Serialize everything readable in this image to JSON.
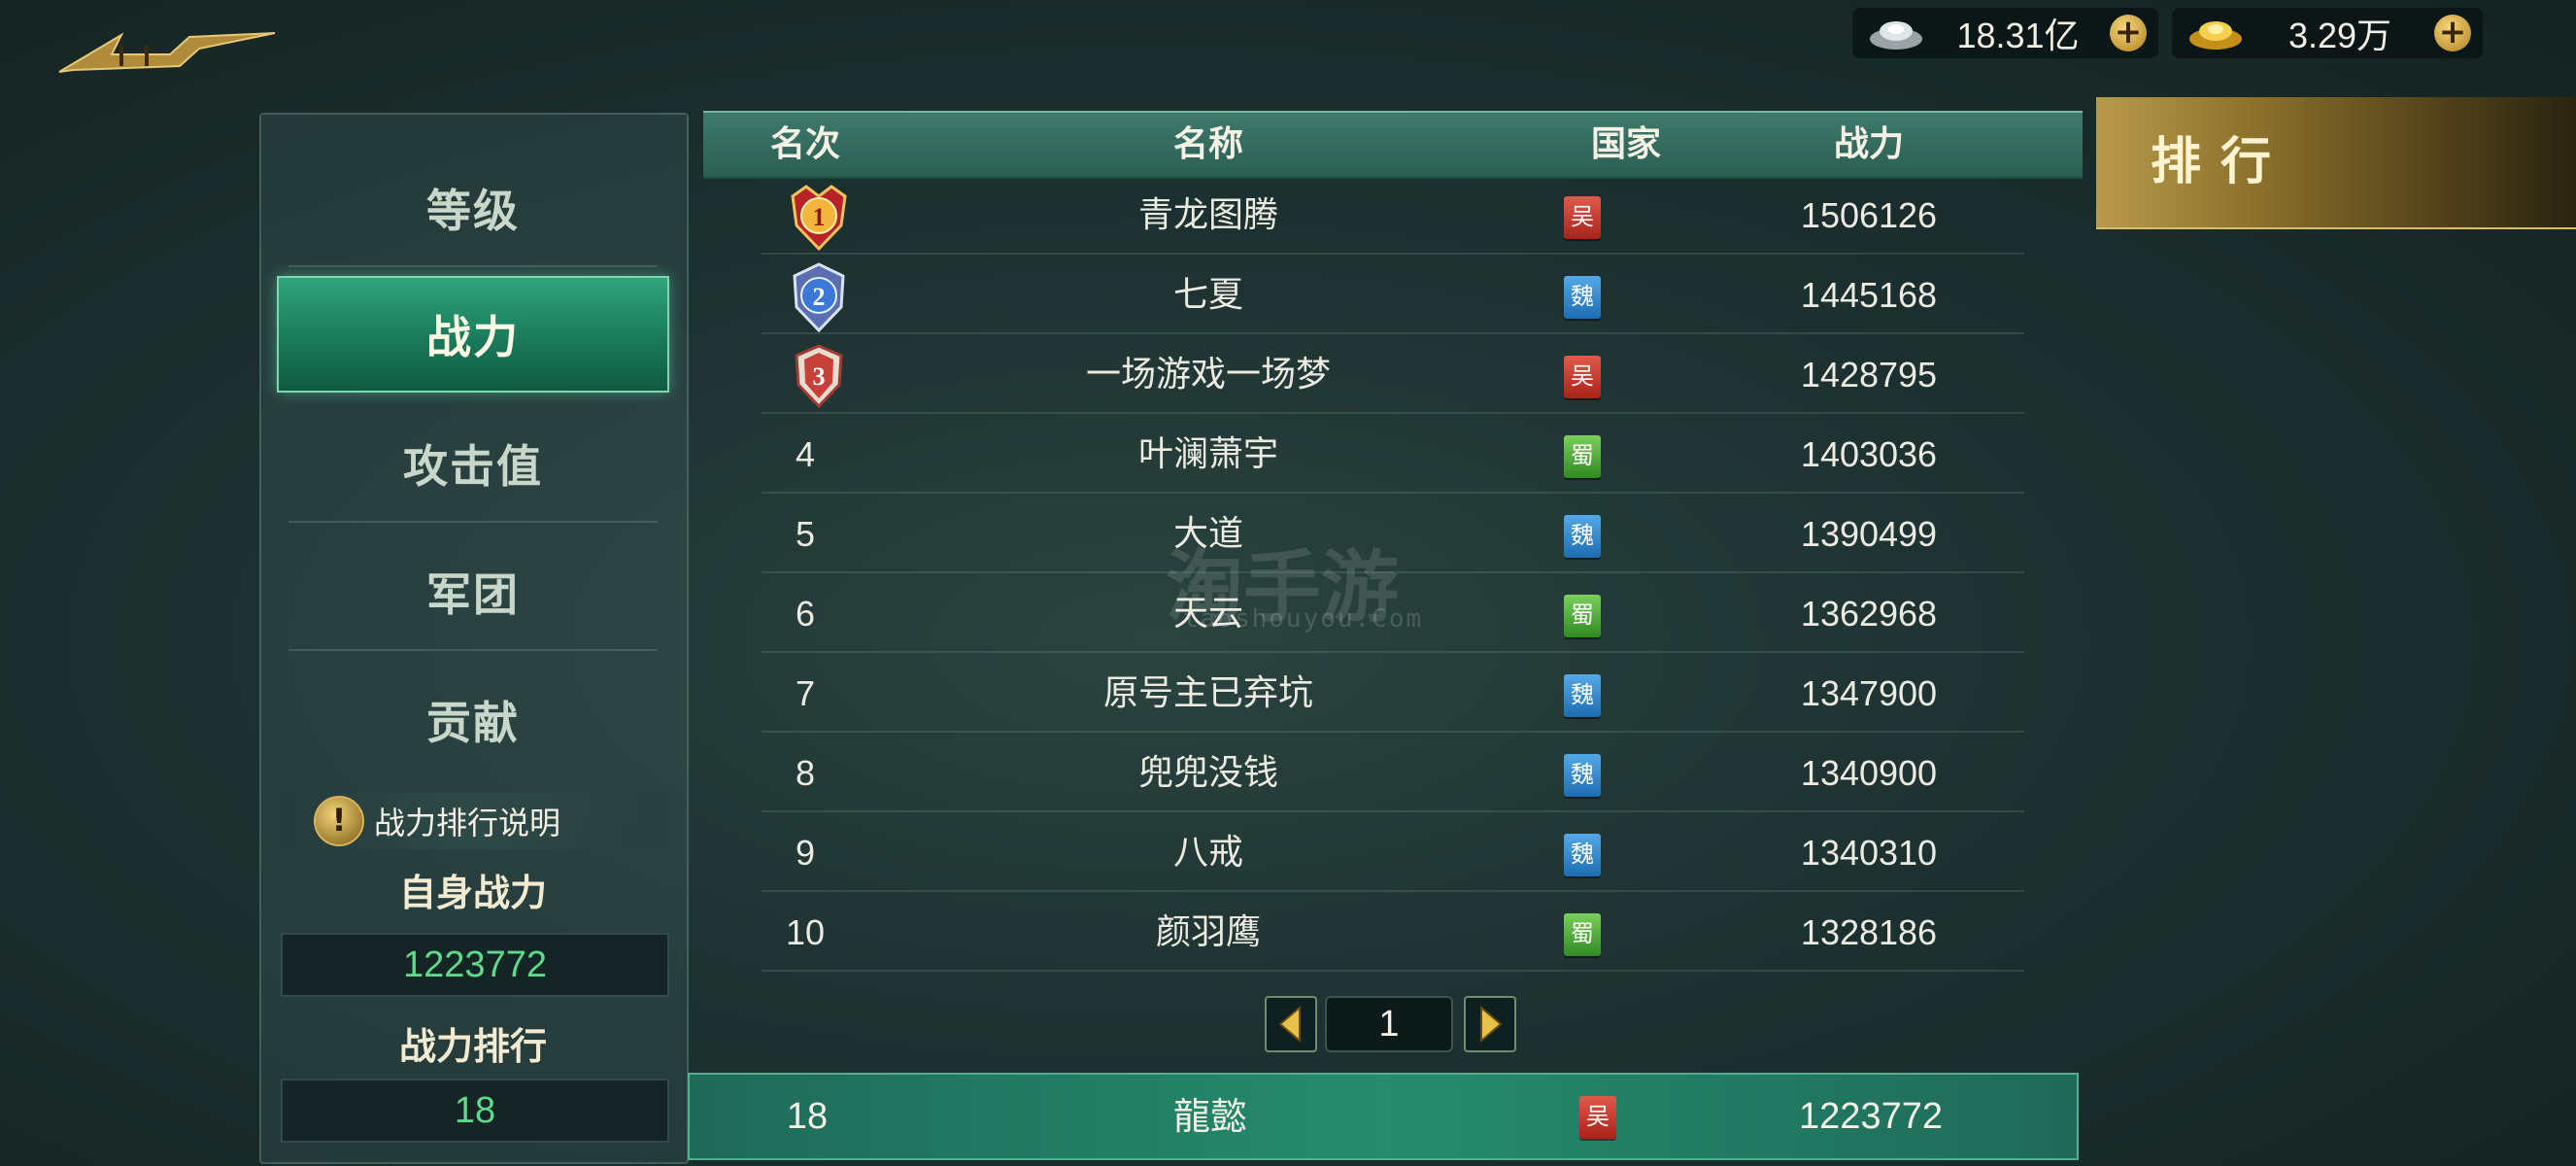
{
  "currency": {
    "silver": {
      "icon": "silver-ingot-icon",
      "value": "18.31亿"
    },
    "gold": {
      "icon": "gold-ingot-icon",
      "value": "3.29万"
    },
    "plus_label": "+"
  },
  "sidebar": {
    "items": [
      {
        "label": "等级",
        "active": false
      },
      {
        "label": "战力",
        "active": true
      },
      {
        "label": "攻击值",
        "active": false
      },
      {
        "label": "军团",
        "active": false
      },
      {
        "label": "贡献",
        "active": false
      }
    ],
    "info_icon_label": "!",
    "info_label": "战力排行说明",
    "self_power_title": "自身战力",
    "self_power_value": "1223772",
    "self_rank_title": "战力排行",
    "self_rank_value": "18"
  },
  "table": {
    "headers": {
      "rank": "名次",
      "name": "名称",
      "country": "国家",
      "power": "战力"
    },
    "rows": [
      {
        "rank": "1",
        "name": "青龙图腾",
        "country": "吴",
        "country_class": "wu",
        "power": "1506126"
      },
      {
        "rank": "2",
        "name": "七夏",
        "country": "魏",
        "country_class": "wei",
        "power": "1445168"
      },
      {
        "rank": "3",
        "name": "一场游戏一场梦",
        "country": "吴",
        "country_class": "wu",
        "power": "1428795"
      },
      {
        "rank": "4",
        "name": "叶澜萧宇",
        "country": "蜀",
        "country_class": "shu",
        "power": "1403036"
      },
      {
        "rank": "5",
        "name": "大道",
        "country": "魏",
        "country_class": "wei",
        "power": "1390499"
      },
      {
        "rank": "6",
        "name": "天云",
        "country": "蜀",
        "country_class": "shu",
        "power": "1362968"
      },
      {
        "rank": "7",
        "name": "原号主已弃坑",
        "country": "魏",
        "country_class": "wei",
        "power": "1347900"
      },
      {
        "rank": "8",
        "name": "兜兜没钱",
        "country": "魏",
        "country_class": "wei",
        "power": "1340900"
      },
      {
        "rank": "9",
        "name": "八戒",
        "country": "魏",
        "country_class": "wei",
        "power": "1340310"
      },
      {
        "rank": "10",
        "name": "颜羽鹰",
        "country": "蜀",
        "country_class": "shu",
        "power": "1328186"
      }
    ]
  },
  "pager": {
    "page": "1"
  },
  "my_row": {
    "rank": "18",
    "name": "龍懿",
    "country": "吴",
    "country_class": "wu",
    "power": "1223772"
  },
  "rank_panel": {
    "title": "排行"
  },
  "watermark": {
    "text": "淘手游",
    "sub": "taoshouyou.Com"
  },
  "colors": {
    "wu": "#c8382a",
    "wei": "#3a8bd0",
    "shu": "#4aa83a",
    "accent": "#2fa57c",
    "gold": "#d8bd6e"
  }
}
